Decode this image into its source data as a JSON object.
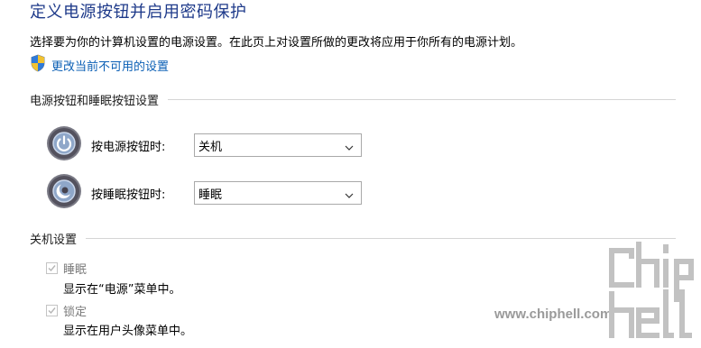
{
  "header": {
    "title": "定义电源按钮并启用密码保护",
    "description": "选择要为你的计算机设置的电源设置。在此页上对设置所做的更改将应用于你所有的电源计划。",
    "change_link": "更改当前不可用的设置",
    "change_link_icon": "uac-shield-icon"
  },
  "power_buttons": {
    "section_label": "电源按钮和睡眠按钮设置",
    "rows": [
      {
        "label": "按电源按钮时:",
        "value": "关机",
        "icon": "power-icon"
      },
      {
        "label": "按睡眠按钮时:",
        "value": "睡眠",
        "icon": "sleep-moon-icon"
      }
    ]
  },
  "shutdown": {
    "section_label": "关机设置",
    "options": [
      {
        "label": "睡眠",
        "description": "显示在“电源”菜单中。",
        "checked": true,
        "enabled": false
      },
      {
        "label": "锁定",
        "description": "显示在用户头像菜单中。",
        "checked": true,
        "enabled": false
      }
    ]
  },
  "watermark": {
    "url": "www.chiphell.com",
    "logo_text": "chiphell"
  },
  "colors": {
    "title": "#1e3a8a",
    "link": "#0b5fb5",
    "disabled_text": "#7a7a7a",
    "rule": "#d5d5d5"
  }
}
